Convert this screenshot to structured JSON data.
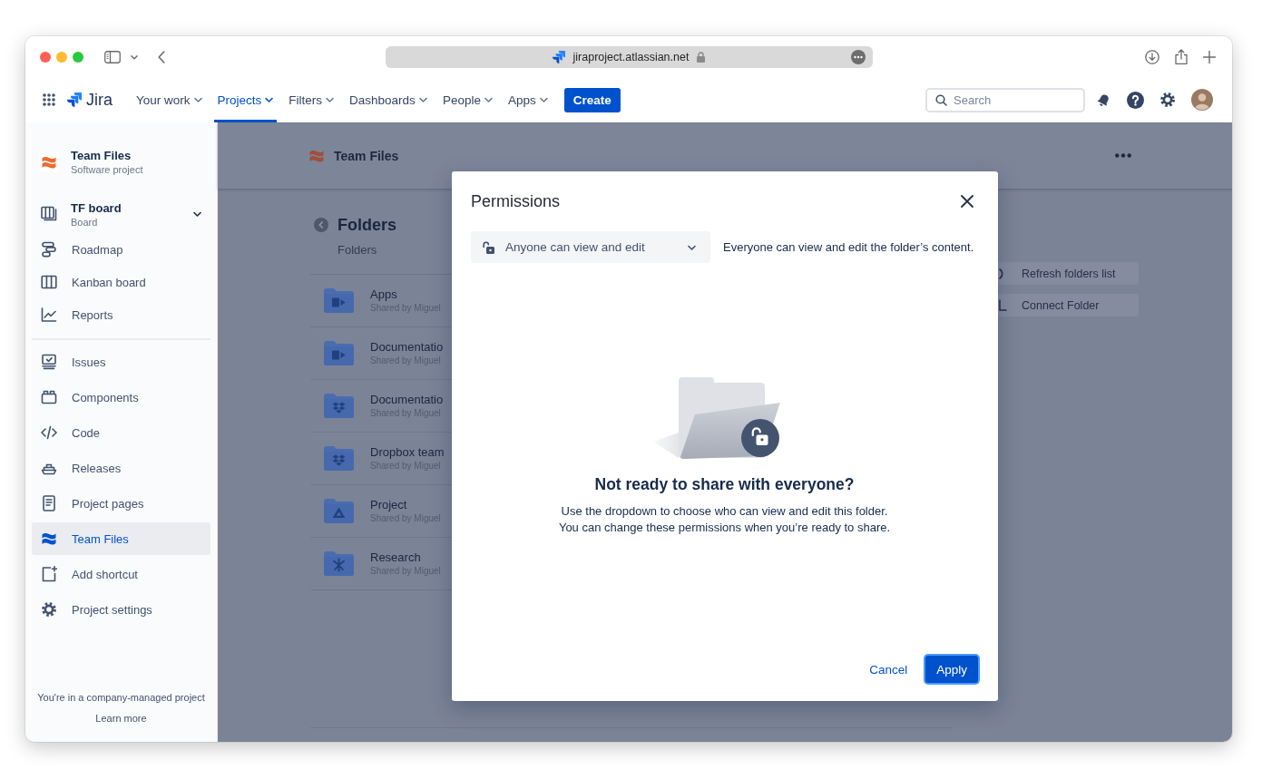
{
  "browser": {
    "url": "jiraproject.atlassian.net"
  },
  "top_nav": {
    "product": "Jira",
    "items": [
      {
        "label": "Your work",
        "selected": false
      },
      {
        "label": "Projects",
        "selected": true
      },
      {
        "label": "Filters",
        "selected": false
      },
      {
        "label": "Dashboards",
        "selected": false
      },
      {
        "label": "People",
        "selected": false
      },
      {
        "label": "Apps",
        "selected": false
      }
    ],
    "create_button": "Create",
    "search": {
      "placeholder": "Search"
    }
  },
  "sidebar": {
    "project": {
      "name": "Team Files",
      "type": "Software project"
    },
    "board": {
      "name": "TF board",
      "type": "Board"
    },
    "sections": [
      {
        "items": [
          {
            "label": "Roadmap",
            "selected": false
          },
          {
            "label": "Kanban board",
            "selected": false
          },
          {
            "label": "Reports",
            "selected": false
          }
        ]
      },
      {
        "items": [
          {
            "label": "Issues",
            "selected": false
          },
          {
            "label": "Components",
            "selected": false
          },
          {
            "label": "Code",
            "selected": false
          },
          {
            "label": "Releases",
            "selected": false
          },
          {
            "label": "Project pages",
            "selected": false
          },
          {
            "label": "Team Files",
            "selected": true
          },
          {
            "label": "Add shortcut",
            "selected": false
          },
          {
            "label": "Project settings",
            "selected": false
          }
        ]
      }
    ],
    "footer": {
      "text": "You're in a company-managed project",
      "link": "Learn more"
    }
  },
  "page": {
    "title": "Team Files",
    "heading": "Folders",
    "subheading": "Folders",
    "folders": [
      {
        "name": "Apps",
        "shared_by": "Shared by Miguel",
        "kind": "sharepoint"
      },
      {
        "name": "Documentatio",
        "shared_by": "Shared by Miguel",
        "kind": "sharepoint"
      },
      {
        "name": "Documentatio",
        "shared_by": "Shared by Miguel",
        "kind": "dropbox"
      },
      {
        "name": "Dropbox team",
        "shared_by": "Shared by Miguel",
        "kind": "dropbox"
      },
      {
        "name": "Project",
        "shared_by": "Shared by Miguel",
        "kind": "drive"
      },
      {
        "name": "Research",
        "shared_by": "Shared by Miguel",
        "kind": "asterisk"
      }
    ],
    "actions": [
      "Refresh folders list",
      "Connect Folder"
    ]
  },
  "dialog": {
    "title": "Permissions",
    "dropdown": {
      "value": "Anyone can view and edit"
    },
    "description": "Everyone can view and edit the folder’s content.",
    "empty_state": {
      "heading": "Not ready to share with everyone?",
      "lines": [
        "Use the dropdown to choose who can view and edit this folder.",
        "You can change these permissions when you’re ready to share."
      ]
    },
    "buttons": [
      {
        "label": "Cancel",
        "kind": "link"
      },
      {
        "label": "Apply",
        "kind": "primary"
      }
    ]
  }
}
